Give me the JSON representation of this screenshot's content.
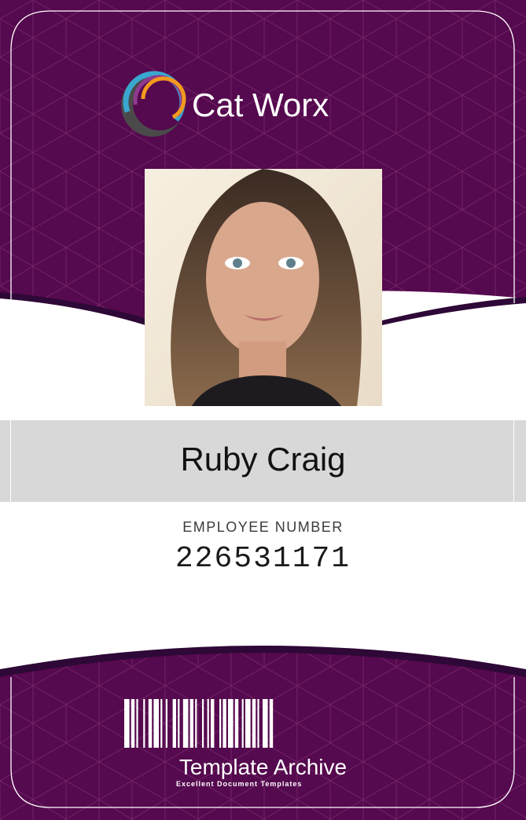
{
  "card": {
    "company_name": "Cat Worx",
    "employee_name": "Ruby Craig",
    "employee_number_label": "EMPLOYEE NUMBER",
    "employee_number": "226531171",
    "brand_name": "Template Archive",
    "brand_tagline": "Excellent Document Templates"
  },
  "colors": {
    "card_purple": "#55094e",
    "card_purple_dark": "#3b0a45",
    "name_band": "#d8d8d8",
    "logo_gray": "#4a4a4a",
    "logo_blue": "#3aa7d0",
    "logo_purple": "#8e3a8e",
    "logo_orange": "#f39a1e"
  },
  "icons": {
    "logo": "cat-worx-logo-icon",
    "barcode": "barcode-icon"
  }
}
